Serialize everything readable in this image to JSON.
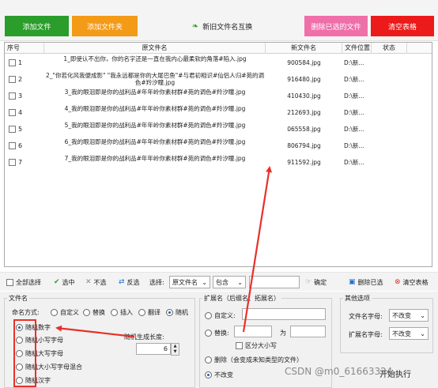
{
  "toolbar": {
    "add_files": "添加文件",
    "add_folder": "添加文件夹",
    "swap_names": "新旧文件名互换",
    "remove_selected": "删除已选的文件",
    "clear_table": "清空表格"
  },
  "table": {
    "headers": [
      "序号",
      "原文件名",
      "新文件名",
      "文件位置",
      "状态"
    ],
    "rows": [
      {
        "num": "1",
        "orig": "1_即使认不出你，你的名字还是一直在我内心最柔软的角落#陷入.jpg",
        "new": "900584.jpg",
        "loc": "D:\\新..."
      },
      {
        "num": "2",
        "orig": "2_\"你若化风我便成影\" \"我永远都是你的大尾巴鱼\"#与君初相识#仙侣人归#苑的调色#羚汐瞳.jpg",
        "new": "916480.jpg",
        "loc": "D:\\新..."
      },
      {
        "num": "3",
        "orig": "3_我的眼泪即是你的战利品#年年岭你素材群#苑的调色#羚汐瞳.jpg",
        "new": "410430.jpg",
        "loc": "D:\\新..."
      },
      {
        "num": "4",
        "orig": "4_我的眼泪即是你的战利品#年年岭你素材群#苑的调色#羚汐瞳.jpg",
        "new": "212693.jpg",
        "loc": "D:\\新..."
      },
      {
        "num": "5",
        "orig": "5_我的眼泪即是你的战利品#年年岭你素材群#苑的调色#羚汐瞳.jpg",
        "new": "065558.jpg",
        "loc": "D:\\新..."
      },
      {
        "num": "6",
        "orig": "6_我的眼泪即是你的战利品#年年岭你素材群#苑的调色#羚汐瞳.jpg",
        "new": "806794.jpg",
        "loc": "D:\\新..."
      },
      {
        "num": "7",
        "orig": "7_我的眼泪即是你的战利品#年年岭你素材群#苑的调色#羚汐瞳.jpg",
        "new": "911592.jpg",
        "loc": "D:\\新..."
      }
    ]
  },
  "selection": {
    "select_all": "全部选择",
    "select": "选中",
    "unselect": "不选",
    "invert": "反选",
    "choose_label": "选择:",
    "field_value": "原文件名",
    "match_value": "包含",
    "confirm": "确定",
    "remove_selected": "删除已选",
    "clear_table": "清空表格"
  },
  "filename": {
    "group_title": "文件名",
    "mode_label": "命名方式:",
    "modes": [
      "自定义",
      "替换",
      "插入",
      "翻译",
      "随机"
    ],
    "random_options": [
      "随机数字",
      "随机小写字母",
      "随机大写字母",
      "随机大小写字母混合",
      "随机汉字"
    ],
    "length_label": "随机生成长度:",
    "length_value": "6"
  },
  "extension": {
    "group_title": "扩展名（后缀名、拓展名）",
    "custom": "自定义:",
    "replace": "替换:",
    "to": "为",
    "case_sensitive": "区分大小写",
    "delete": "删除（会变成未知类型的文件）",
    "unchanged": "不改变"
  },
  "other": {
    "group_title": "其他选项",
    "filename_case_label": "文件名字母:",
    "filename_case_value": "不改变",
    "ext_case_label": "扩展名字母:",
    "ext_case_value": "不改变",
    "start_button": "开始执行"
  },
  "watermark": "CSDN @m0_61663324",
  "colors": {
    "green": "#2a9d2a",
    "orange": "#f39a17",
    "pink": "#ef6fa9",
    "red": "#ec1a1a",
    "arrow": "#e8302a"
  }
}
